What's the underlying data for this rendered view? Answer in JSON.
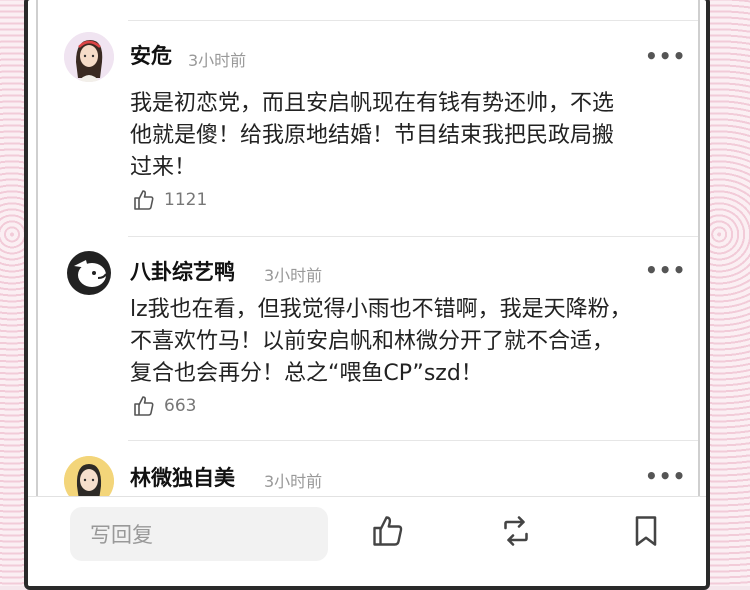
{
  "comments": [
    {
      "username": "安危",
      "time": "3小时前",
      "text": "我是初恋党，而且安启帆现在有钱有势还帅，不选\n他就是傻！给我原地结婚！节目结束我把民政局搬\n过来！",
      "likes": "1121"
    },
    {
      "username": "八卦综艺鸭",
      "time": "3小时前",
      "text": "lz我也在看，但我觉得小雨也不错啊，我是天降粉，\n不喜欢竹马！以前安启帆和林微分开了就不合适，\n复合也会再分！总之“喂鱼CP”szd！",
      "likes": "663"
    },
    {
      "username": "林微独自美",
      "time": "3小时前"
    }
  ],
  "bottom_bar": {
    "reply_placeholder": "写回复"
  }
}
